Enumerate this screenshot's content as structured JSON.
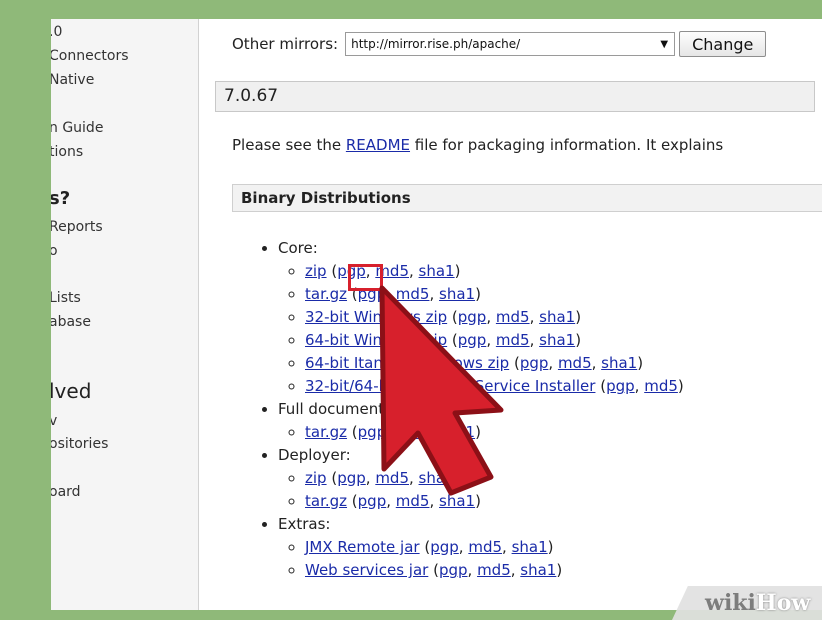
{
  "sidebar": {
    "items": [
      ".0",
      "Connectors",
      "Native",
      "n Guide",
      "tions",
      "s?",
      "Reports",
      "o",
      "Lists",
      "abase",
      "lved",
      "v",
      "ositories",
      "oard"
    ]
  },
  "mirrors": {
    "label": "Other mirrors:",
    "selected": "http://mirror.rise.ph/apache/",
    "change_label": "Change"
  },
  "version": "7.0.67",
  "readme": {
    "prefix": "Please see the ",
    "link": "README",
    "suffix": " file for packaging information. It explains"
  },
  "section_title": "Binary Distributions",
  "distributions": {
    "core": {
      "label": "Core:",
      "items": [
        {
          "file": "zip",
          "links": [
            "pgp",
            "md5",
            "sha1"
          ]
        },
        {
          "file": "tar.gz",
          "links": [
            "pgp",
            "md5",
            "sha1"
          ]
        },
        {
          "file": "32-bit Windows zip",
          "links": [
            "pgp",
            "md5",
            "sha1"
          ]
        },
        {
          "file": "64-bit Windows zip",
          "links": [
            "pgp",
            "md5",
            "sha1"
          ]
        },
        {
          "file": "64-bit Itanium Windows zip",
          "links": [
            "pgp",
            "md5",
            "sha1"
          ]
        },
        {
          "file": "32-bit/64-bit Windows Service Installer",
          "links": [
            "pgp",
            "md5"
          ]
        }
      ]
    },
    "full_docs": {
      "label": "Full documentation:",
      "items": [
        {
          "file": "tar.gz",
          "links": [
            "pgp",
            "md5",
            "sha1"
          ]
        }
      ]
    },
    "deployer": {
      "label": "Deployer:",
      "items": [
        {
          "file": "zip",
          "links": [
            "pgp",
            "md5",
            "sha1"
          ]
        },
        {
          "file": "tar.gz",
          "links": [
            "pgp",
            "md5",
            "sha1"
          ]
        }
      ]
    },
    "extras": {
      "label": "Extras:",
      "items": [
        {
          "file": "JMX Remote jar",
          "links": [
            "pgp",
            "md5",
            "sha1"
          ]
        },
        {
          "file": "Web services jar",
          "links": [
            "pgp",
            "md5",
            "sha1"
          ]
        }
      ]
    }
  },
  "watermark": {
    "part1": "wiki",
    "part2": "How"
  },
  "colors": {
    "link": "#1a2ba8",
    "highlight": "#d7202c",
    "cursor": "#d7202c",
    "frame": "#8fb979"
  }
}
